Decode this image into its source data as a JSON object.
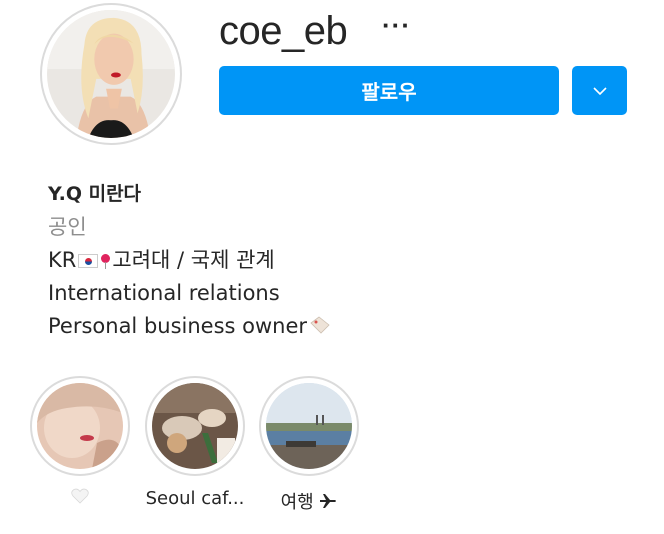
{
  "profile": {
    "username": "coe_eb",
    "more_label": "···",
    "follow_label": "팔로우"
  },
  "bio": {
    "name": "Y.Q 미란다",
    "category": "공인",
    "line1_prefix": "KR",
    "line1_text": "고려대 / 국제 관계",
    "line2": "International relations",
    "line3": "Personal business owner"
  },
  "highlights": [
    {
      "label": ""
    },
    {
      "label": "Seoul caf..."
    },
    {
      "label": "여행"
    }
  ],
  "colors": {
    "accent": "#0095f6",
    "text": "#262626",
    "muted": "#8e8e8e",
    "ring": "#dbdbdb"
  },
  "icons": {
    "more": "ellipsis-icon",
    "dropdown": "chevron-down-icon",
    "flag": "korea-flag-icon",
    "pin": "pin-icon",
    "tag": "label-tag-icon",
    "heart": "white-heart-icon",
    "plane": "airplane-icon"
  }
}
